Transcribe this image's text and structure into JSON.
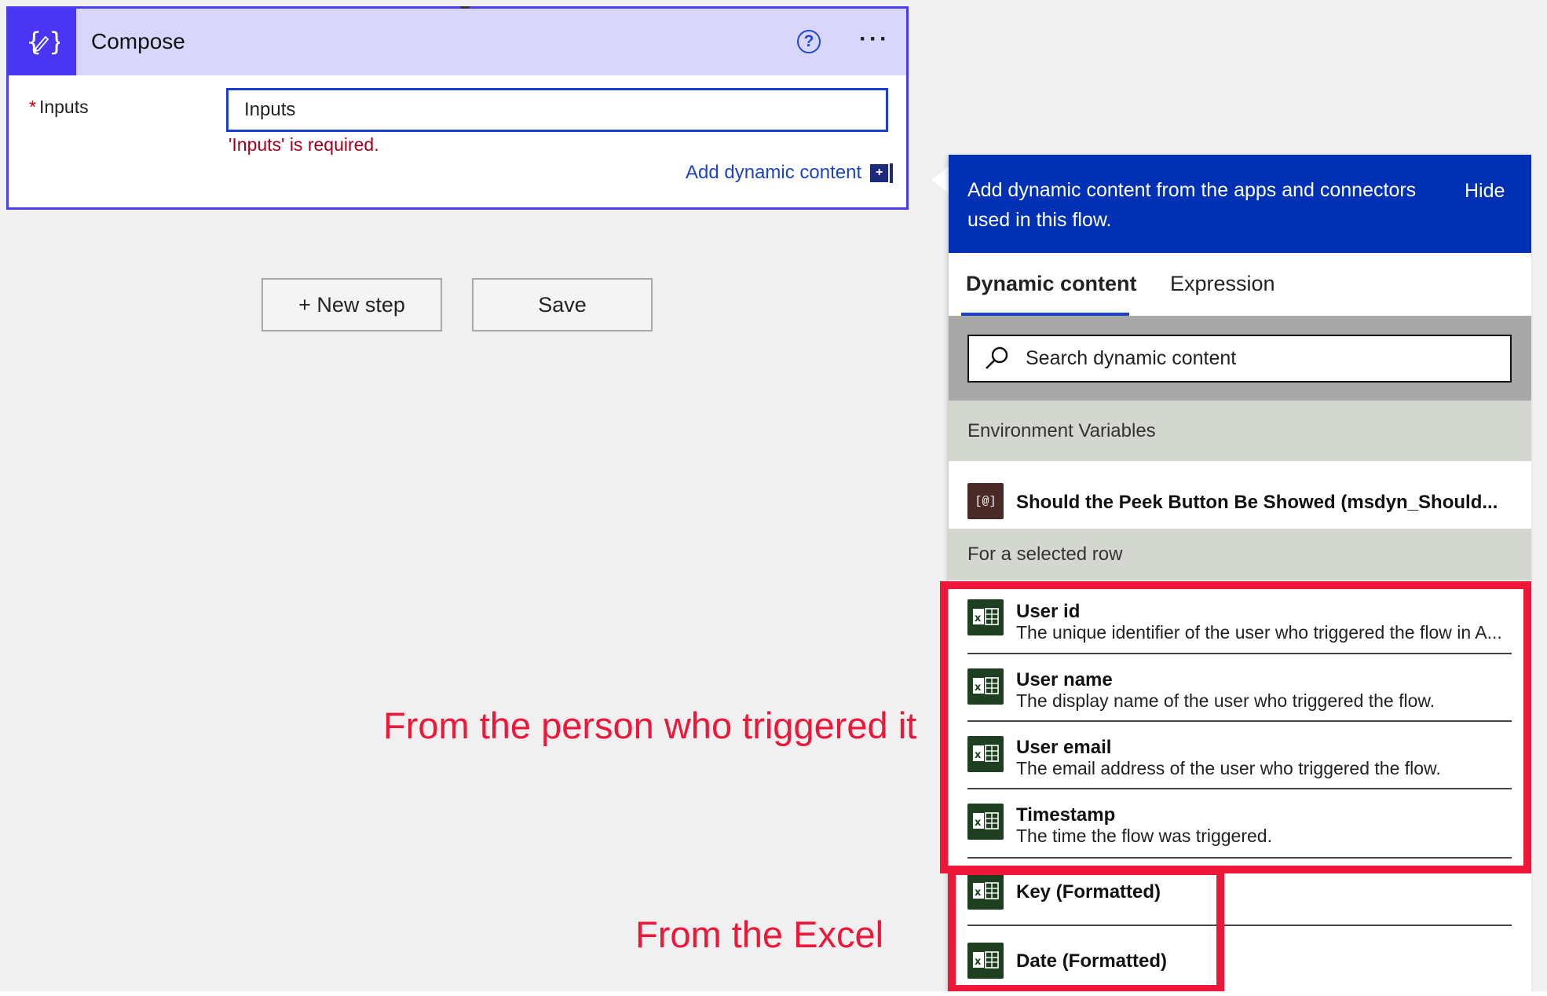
{
  "compose": {
    "title": "Compose",
    "field_label": "Inputs",
    "required_mark": "*",
    "input_value": "Inputs",
    "error": "'Inputs' is required.",
    "add_dynamic": "Add dynamic content",
    "add_dynamic_glyph": "+"
  },
  "buttons": {
    "new_step": "+ New step",
    "save": "Save"
  },
  "panel": {
    "header_text": "Add dynamic content from the apps and connectors used in this flow.",
    "hide": "Hide",
    "tabs": [
      "Dynamic content",
      "Expression"
    ],
    "search_placeholder": "Search dynamic content",
    "sections": {
      "env": {
        "title": "Environment Variables",
        "items": [
          {
            "name": "Should the Peek Button Be Showed (msdyn_Should...",
            "icon_text": "[@]"
          }
        ]
      },
      "row": {
        "title": "For a selected row",
        "items": [
          {
            "name": "User id",
            "desc": "The unique identifier of the user who triggered the flow in A..."
          },
          {
            "name": "User name",
            "desc": "The display name of the user who triggered the flow."
          },
          {
            "name": "User email",
            "desc": "The email address of the user who triggered the flow."
          },
          {
            "name": "Timestamp",
            "desc": "The time the flow was triggered."
          },
          {
            "name": "Key (Formatted)",
            "desc": ""
          },
          {
            "name": "Date (Formatted)",
            "desc": ""
          }
        ]
      }
    }
  },
  "annotations": {
    "person": "From the person who triggered it",
    "excel": "From the Excel"
  },
  "colors": {
    "accent": "#4b35f5",
    "panel_header": "#0031b4",
    "annotation": "#ee1739",
    "excel_icon": "#1e4020"
  }
}
